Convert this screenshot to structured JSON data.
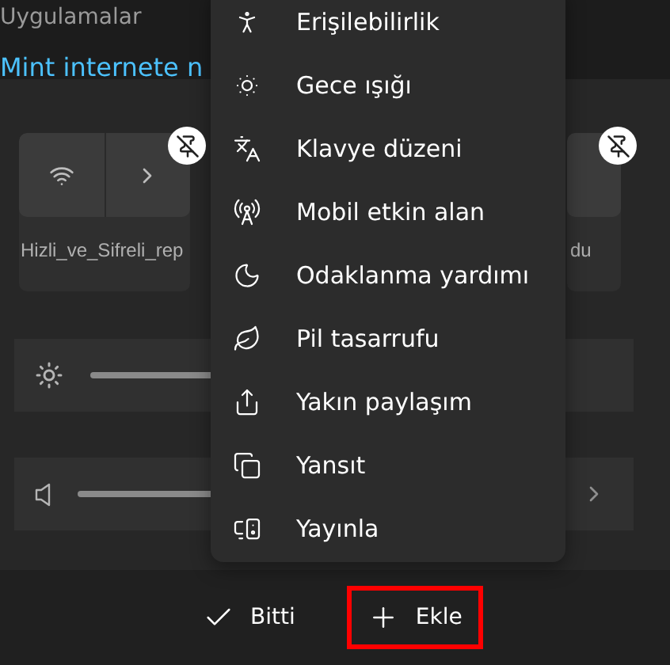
{
  "background": {
    "section_title": "Uygulamalar",
    "link": "Mint internete n"
  },
  "quick_settings": {
    "tiles": [
      {
        "kind": "wifi",
        "label": "Hizli_ve_Sifreli_rep"
      },
      {
        "kind": "partial",
        "label": "du"
      }
    ],
    "sliders": [
      {
        "kind": "brightness"
      },
      {
        "kind": "volume"
      }
    ]
  },
  "menu": {
    "items": [
      {
        "kind": "accessibility",
        "label": "Erişilebilirlik"
      },
      {
        "kind": "night_light",
        "label": "Gece ışığı"
      },
      {
        "kind": "keyboard",
        "label": "Klavye düzeni"
      },
      {
        "kind": "hotspot",
        "label": "Mobil etkin alan"
      },
      {
        "kind": "focus",
        "label": "Odaklanma yardımı"
      },
      {
        "kind": "battery_saver",
        "label": "Pil tasarrufu"
      },
      {
        "kind": "nearby_share",
        "label": "Yakın paylaşım"
      },
      {
        "kind": "project",
        "label": "Yansıt"
      },
      {
        "kind": "cast",
        "label": "Yayınla"
      }
    ]
  },
  "footer": {
    "buttons": [
      {
        "kind": "done",
        "label": "Bitti",
        "highlighted": false
      },
      {
        "kind": "add",
        "label": "Ekle",
        "highlighted": true
      }
    ]
  }
}
